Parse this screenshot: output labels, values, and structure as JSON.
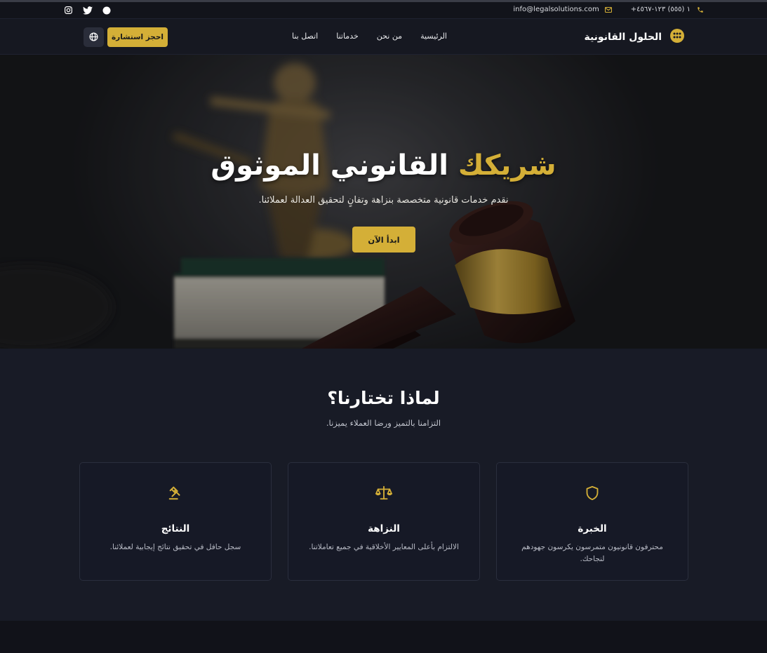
{
  "topbar": {
    "phone": "+١ (٥٥٥) ١٢٣-٤٥٦٧",
    "email": "info@legalsolutions.com",
    "socials": [
      "instagram-icon",
      "twitter-icon",
      "circle-icon"
    ]
  },
  "nav": {
    "brand": "الحلول القانونية",
    "menu": [
      "الرئيسية",
      "من نحن",
      "خدماتنا",
      "اتصل بنا"
    ],
    "cta": "احجز استشارة"
  },
  "hero": {
    "title_highlight": "شريكك",
    "title_rest": "القانوني الموثوق",
    "subtitle": "نقدم خدمات قانونية متخصصة بنزاهة وتفانٍ لتحقيق العدالة لعملائنا.",
    "button": "ابدأ الآن"
  },
  "why": {
    "title": "لماذا تختارنا؟",
    "subtitle": "التزامنا بالتميز ورضا العملاء يميزنا.",
    "cards": [
      {
        "icon": "shield-icon",
        "title": "الخبرة",
        "desc": "محترفون قانونيون متمرسون يكرسون جهودهم لنجاحك."
      },
      {
        "icon": "scales-icon",
        "title": "النزاهة",
        "desc": "الالتزام بأعلى المعايير الأخلاقية في جميع تعاملاتنا."
      },
      {
        "icon": "gavel-icon",
        "title": "النتائج",
        "desc": "سجل حافل في تحقيق نتائج إيجابية لعملائنا."
      }
    ]
  },
  "colors": {
    "accent": "#d4af37",
    "background": "#181b26",
    "nav_background": "#161821"
  }
}
